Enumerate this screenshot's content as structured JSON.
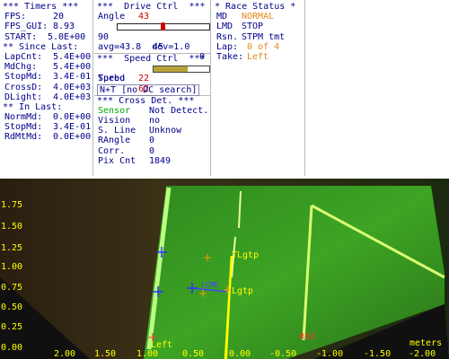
{
  "timers": {
    "title": "*** Timers ***",
    "fps_label": "FPS:",
    "fps": "20",
    "fps_gui_label": "FPS_GUI:",
    "fps_gui": "8.93",
    "start_label": "START:",
    "start": "5.0E+00",
    "since_title": "** Since Last:",
    "lapcnt_label": "LapCnt:",
    "lapcnt": "5.4E+00",
    "mdchg_label": "MdChg:",
    "mdchg": "5.4E+00",
    "stopmd_label": "StopMd:",
    "stopmd": "3.4E-01",
    "crossd_label": "CrossD:",
    "crossd": "4.0E+03",
    "dlight_label": "DLight:",
    "dlight": "4.0E+03",
    "in_title": "** In Last:",
    "normmd_label": "NormMd:",
    "normmd": "0.0E+00",
    "stopmd2_label": "StopMd:",
    "stopmd2": "3.4E-01",
    "rdmtmd_label": "RdMtMd:",
    "rdmtmd": "0.0E+00"
  },
  "drive": {
    "title": "***  Drive Ctrl  ***",
    "angle_label": "Angle",
    "angle": "43",
    "slider_min": "90",
    "slider_max": "0",
    "slider_value": 45,
    "slider_center": "45",
    "avg_text": "avg=43.8  dev=1.0",
    "speed_title": "***  Speed Ctrl  ***",
    "speed_label": "Speed",
    "speed": "62",
    "speed_fraction": 0.62,
    "turbo_label": "Turbo",
    "turbo": "22",
    "nt_text": "N+T [no DC search]",
    "cross_title": "*** Cross Det. ***",
    "sensor_label": "Sensor",
    "sensor_value": "Not Detect.",
    "vision_label": "Vision",
    "vision_value": "no",
    "sline_label": "S. Line",
    "sline_value": "Unknow",
    "rangle_label": "RAngle",
    "rangle_value": "0",
    "corr_label": "Corr.",
    "corr_value": "0",
    "pix_label": "Pix Cnt",
    "pix_value": "1849"
  },
  "race": {
    "title": "* Race Status *",
    "md_label": "MD",
    "md": "NORMAL",
    "lmd_label": "LMD",
    "lmd": "STOP",
    "rsn_label": "Rsn.",
    "rsn": "STPM tmt",
    "lap_label": "Lap:",
    "lap": "0 of 4",
    "take_label": "Take:",
    "take": "Left"
  },
  "camera": {
    "y_ticks": [
      "1.75",
      "1.50",
      "1.25",
      "1.00",
      "0.75",
      "0.50",
      "0.25",
      "0.00"
    ],
    "x_ticks": [
      "2.00",
      "1.50",
      "1.00",
      "0.50",
      "0.00",
      "-0.50",
      "-1.00",
      "-1.50",
      "-2.00"
    ],
    "units": "meters",
    "label_left": "Left",
    "label_lgtp_top": "TLgtp",
    "label_lgtp_mid": "Lgtp",
    "label_r63": "R63",
    "label_blue": "LCMD"
  },
  "colors": {
    "text": "#00008b",
    "accent_red": "#cc0000",
    "accent_orange": "#e08a1e",
    "accent_green": "#00aa00",
    "overlay_yellow": "#ffff00"
  }
}
